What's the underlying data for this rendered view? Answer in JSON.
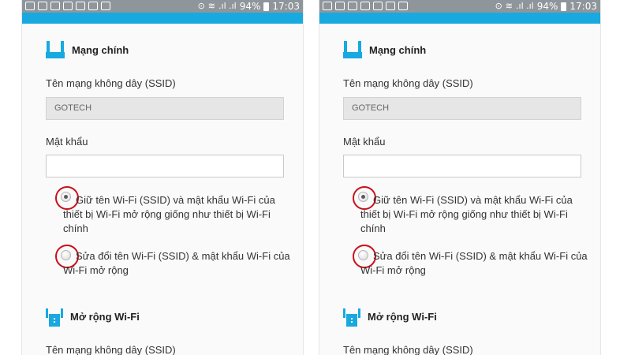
{
  "status": {
    "signal": ".ıl .ıl",
    "battery": "94%",
    "time": "17:03"
  },
  "colors": {
    "accent": "#18a9e0",
    "status_bar": "#8f969b",
    "highlight_ring": "#c8101a"
  },
  "main_network": {
    "icon": "router-icon",
    "title": "Mạng chính",
    "ssid_label": "Tên mạng không dây (SSID)",
    "ssid_value": "GOTECH",
    "password_label": "Mật khẩu",
    "password_value": ""
  },
  "options": {
    "keep_label": "Giữ tên Wi-Fi (SSID) và mật khẩu Wi-Fi của thiết bị Wi-Fi mở rộng giống như thiết bị Wi-Fi chính",
    "keep_selected": true,
    "modify_label": "Sửa đổi tên Wi-Fi (SSID) & mật khẩu Wi-Fi của Wi-Fi mở rộng",
    "modify_selected": false
  },
  "extender": {
    "icon": "extender-icon",
    "title": "Mở rộng Wi-Fi",
    "ssid_label": "Tên mạng không dây (SSID)"
  }
}
